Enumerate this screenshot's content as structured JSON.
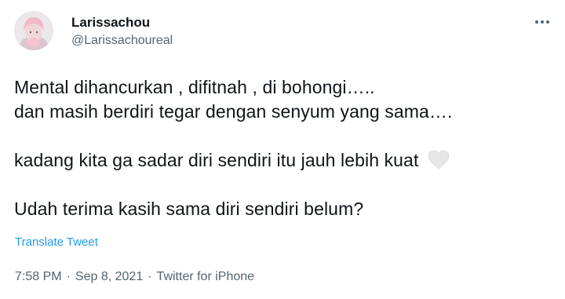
{
  "user": {
    "display_name": "Larissachou",
    "handle": "@Larissachoureal"
  },
  "tweet": {
    "lines": [
      "Mental dihancurkan , difitnah , di bohongi…..",
      "dan masih berdiri tegar dengan senyum yang sama….",
      "kadang kita ga sadar diri sendiri itu jauh lebih kuat",
      "Udah terima kasih sama diri sendiri belum?"
    ],
    "emoji": "white-heart-icon"
  },
  "translate_label": "Translate Tweet",
  "meta": {
    "time": "7:58 PM",
    "date": "Sep 8, 2021",
    "source": "Twitter for iPhone",
    "separator": "·"
  },
  "icons": {
    "more": "more-horizontal-icon"
  },
  "colors": {
    "text": "#0f1419",
    "secondary": "#536471",
    "link": "#1d9bf0",
    "heart": "#e6e6e6"
  }
}
